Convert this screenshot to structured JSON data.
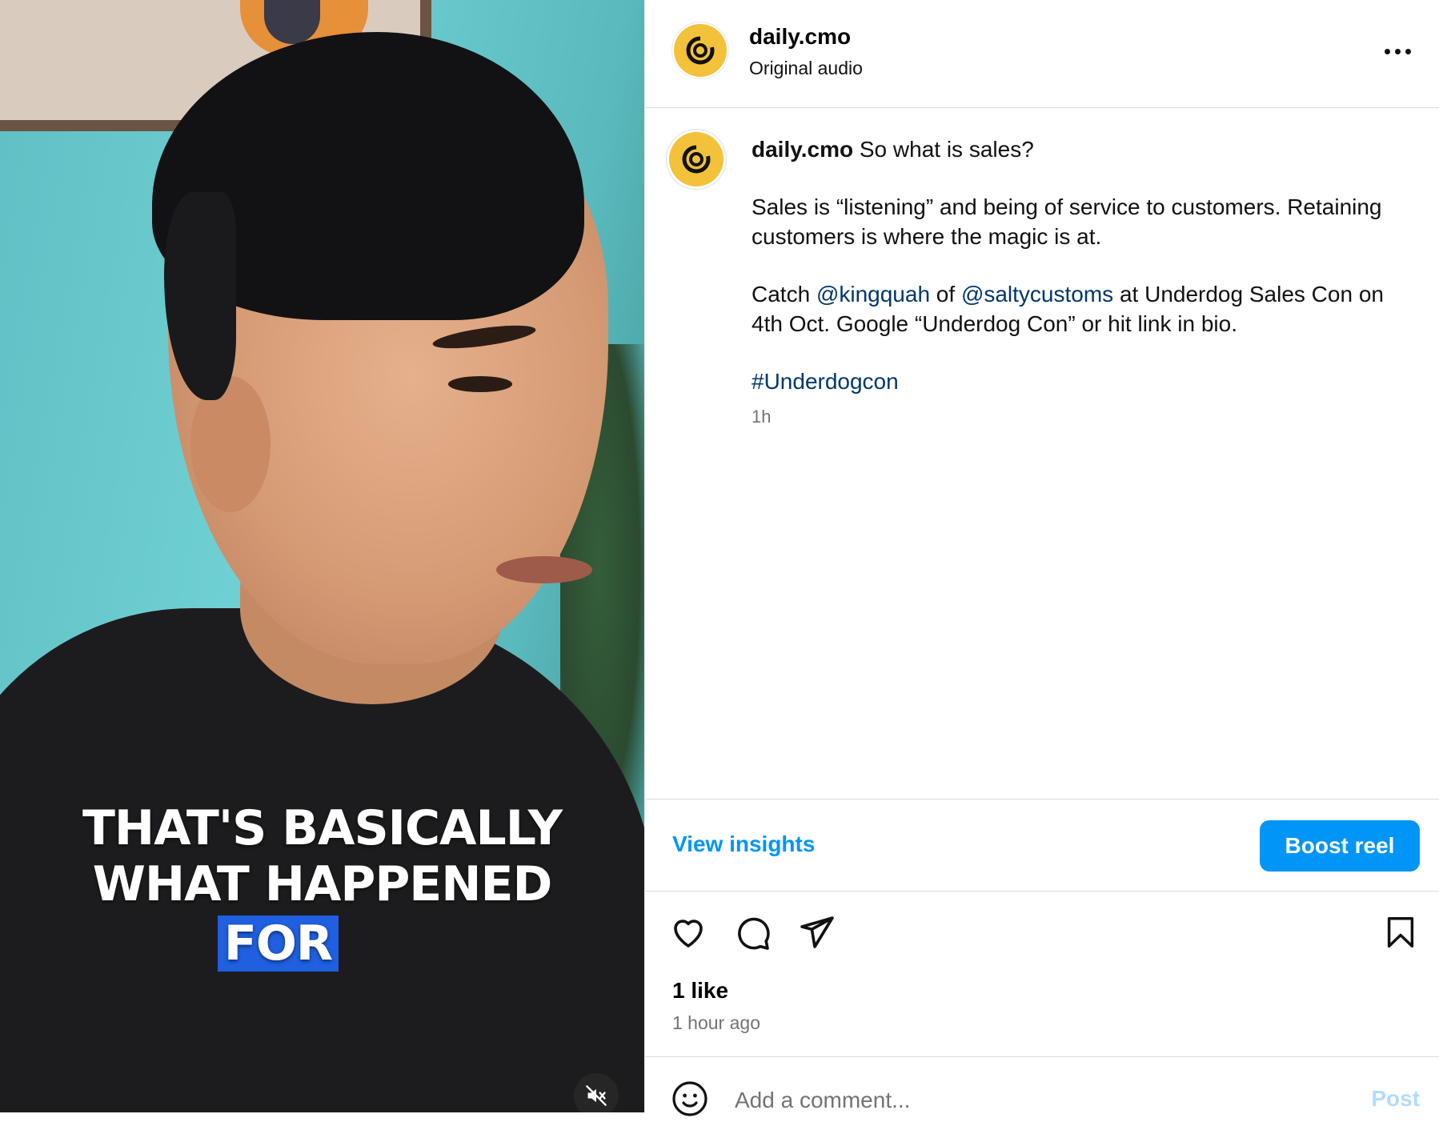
{
  "video": {
    "caption_lines": [
      "THAT'S BASICALLY",
      "WHAT HAPPENED"
    ],
    "caption_highlight": "FOR",
    "highlight_color": "#1f5fe0",
    "mute_icon": "speaker-muted-icon"
  },
  "header": {
    "username": "daily.cmo",
    "subtitle": "Original audio",
    "more_icon": "more-horizontal-icon"
  },
  "caption": {
    "username": "daily.cmo",
    "first_line": "So what is sales?",
    "para1": "Sales is “listening” and being of service to customers. Retaining customers is where the magic is at.",
    "para2_pre": "Catch ",
    "mention1": "@kingquah",
    "para2_mid": " of ",
    "mention2": "@saltycustoms",
    "para2_post": " at Underdog Sales Con on 4th Oct. Google “Underdog Con” or hit link in bio.",
    "hashtag": "#Underdogcon",
    "time": "1h"
  },
  "insights": {
    "view_insights_label": "View insights",
    "boost_label": "Boost reel",
    "accent_color": "#0095f6"
  },
  "actions": {
    "icons": [
      "heart-icon",
      "comment-icon",
      "share-icon",
      "bookmark-icon"
    ],
    "likes": "1 like",
    "posted": "1 hour ago"
  },
  "comment": {
    "placeholder": "Add a comment...",
    "post_label": "Post",
    "emoji_icon": "smiley-icon"
  }
}
